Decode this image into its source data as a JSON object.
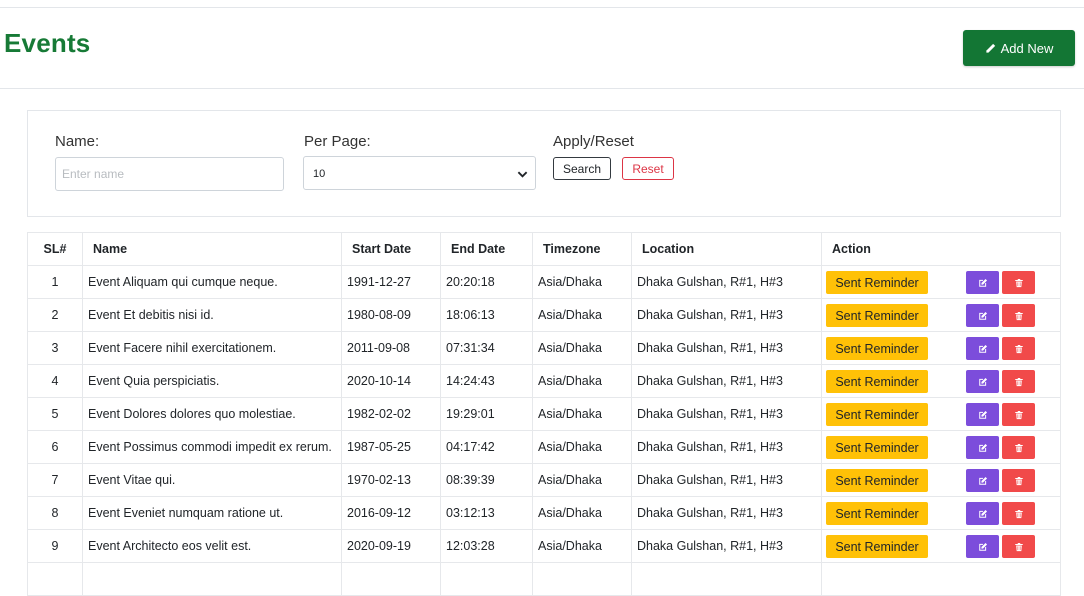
{
  "header": {
    "title": "Events",
    "add_button_label": "Add New"
  },
  "filters": {
    "name_label": "Name:",
    "name_placeholder": "Enter name",
    "name_value": "",
    "per_page_label": "Per Page:",
    "per_page_value": "10",
    "apply_label": "Apply/Reset",
    "search_label": "Search",
    "reset_label": "Reset"
  },
  "table": {
    "columns": [
      "SL#",
      "Name",
      "Start Date",
      "End Date",
      "Timezone",
      "Location",
      "Action"
    ],
    "action_label": "Sent Reminder",
    "rows": [
      {
        "sl": "1",
        "name": "Event Aliquam qui cumque neque.",
        "start": "1991-12-27",
        "end": "20:20:18",
        "tz": "Asia/Dhaka",
        "location": "Dhaka Gulshan, R#1, H#3"
      },
      {
        "sl": "2",
        "name": "Event Et debitis nisi id.",
        "start": "1980-08-09",
        "end": "18:06:13",
        "tz": "Asia/Dhaka",
        "location": "Dhaka Gulshan, R#1, H#3"
      },
      {
        "sl": "3",
        "name": "Event Facere nihil exercitationem.",
        "start": "2011-09-08",
        "end": "07:31:34",
        "tz": "Asia/Dhaka",
        "location": "Dhaka Gulshan, R#1, H#3"
      },
      {
        "sl": "4",
        "name": "Event Quia perspiciatis.",
        "start": "2020-10-14",
        "end": "14:24:43",
        "tz": "Asia/Dhaka",
        "location": "Dhaka Gulshan, R#1, H#3"
      },
      {
        "sl": "5",
        "name": "Event Dolores dolores quo molestiae.",
        "start": "1982-02-02",
        "end": "19:29:01",
        "tz": "Asia/Dhaka",
        "location": "Dhaka Gulshan, R#1, H#3"
      },
      {
        "sl": "6",
        "name": "Event Possimus commodi impedit ex rerum.",
        "start": "1987-05-25",
        "end": "04:17:42",
        "tz": "Asia/Dhaka",
        "location": "Dhaka Gulshan, R#1, H#3"
      },
      {
        "sl": "7",
        "name": "Event Vitae qui.",
        "start": "1970-02-13",
        "end": "08:39:39",
        "tz": "Asia/Dhaka",
        "location": "Dhaka Gulshan, R#1, H#3"
      },
      {
        "sl": "8",
        "name": "Event Eveniet numquam ratione ut.",
        "start": "2016-09-12",
        "end": "03:12:13",
        "tz": "Asia/Dhaka",
        "location": "Dhaka Gulshan, R#1, H#3"
      },
      {
        "sl": "9",
        "name": "Event Architecto eos velit est.",
        "start": "2020-09-19",
        "end": "12:03:28",
        "tz": "Asia/Dhaka",
        "location": "Dhaka Gulshan, R#1, H#3"
      },
      {
        "sl": "",
        "name": "",
        "start": "",
        "end": "",
        "tz": "",
        "location": ""
      }
    ]
  },
  "icons": {
    "add": "pencil-icon",
    "per_page_caret": "chevron-down-icon",
    "edit": "edit-icon",
    "delete": "trash-icon"
  },
  "colors": {
    "title": "#177a36",
    "add_button": "#137634",
    "reminder_button": "#ffc107",
    "edit_button": "#7c4ddb",
    "delete_button": "#f14a4a",
    "reset_border": "#dc3545"
  }
}
